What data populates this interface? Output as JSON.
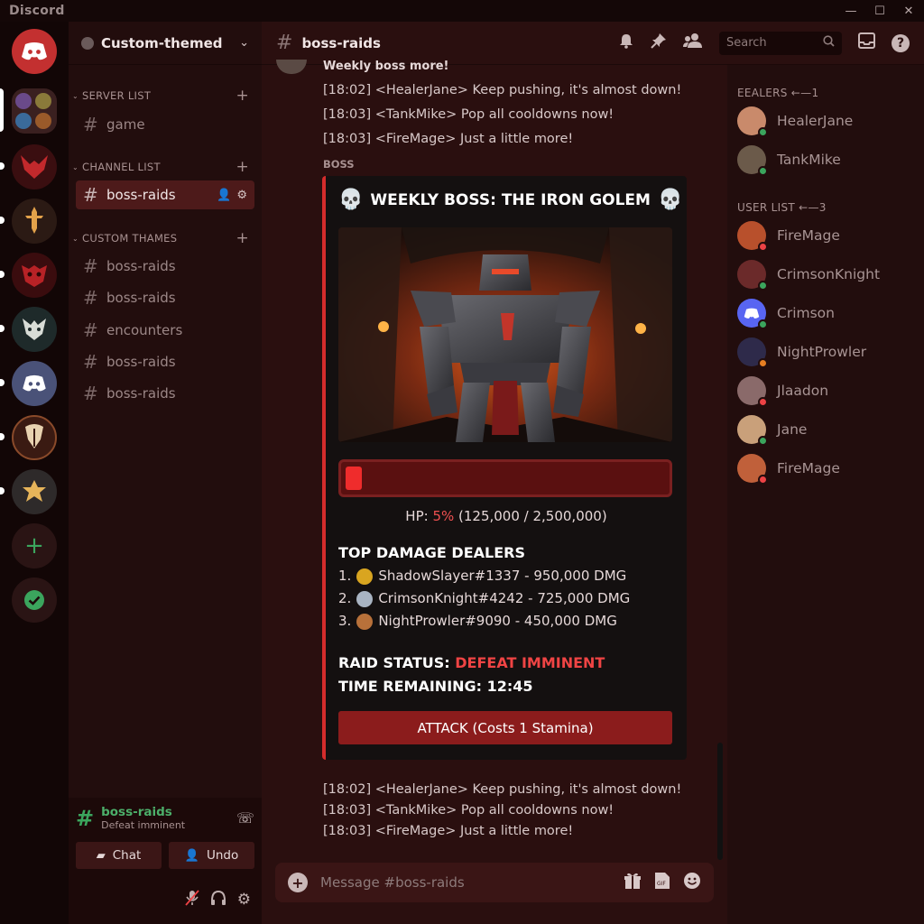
{
  "window": {
    "app_name": "Discord",
    "controls": [
      "—",
      "☐",
      "✕"
    ]
  },
  "server": {
    "name": "Custom-themed"
  },
  "sidebar": {
    "categories": [
      {
        "label": "SERVER LIST",
        "channels": [
          "game"
        ]
      },
      {
        "label": "CHANNEL LIST",
        "channels": [
          "boss-raids"
        ]
      },
      {
        "label": "CUSTOM THAMES",
        "channels": [
          "boss-raids",
          "boss-raids",
          "encounters",
          "boss-raids",
          "boss-raids"
        ]
      }
    ],
    "active_channel": "boss-raids"
  },
  "voice": {
    "channel": "boss-raids",
    "subtitle": "Defeat imminent",
    "chat_label": "Chat",
    "undo_label": "Undo"
  },
  "topbar": {
    "channel": "boss-raids",
    "search_placeholder": "Search"
  },
  "messages": {
    "partial_header": "Weekly boss more!",
    "top": [
      "[18:02] <HealerJane> Keep pushing, it's almost down!",
      "[18:03] <TankMike> Pop all cooldowns now!",
      "[18:03] <FireMage> Just a little more!"
    ],
    "bottom": [
      "[18:02] <HealerJane> Keep pushing, it's almost down!",
      "[18:03] <TankMike> Pop all cooldowns now!",
      "[18:03] <FireMage> Just a little more!"
    ]
  },
  "embed": {
    "author": "BOSS",
    "title": "WEEKLY BOSS: THE IRON GOLEM",
    "hp_prefix": "HP: ",
    "hp_pct": "5%",
    "hp_detail": " (125,000 / 2,500,000)",
    "hp_fraction": 0.05,
    "dealers_title": "TOP DAMAGE DEALERS",
    "dealers": [
      {
        "rank": "1.",
        "text": "ShadowSlayer#1337 - 950,000 DMG",
        "medal_color": "#d9a520"
      },
      {
        "rank": "2.",
        "text": "CrimsonKnight#4242 - 725,000 DMG",
        "medal_color": "#a9b4c2"
      },
      {
        "rank": "3.",
        "text": "NightProwler#9090 - 450,000 DMG",
        "medal_color": "#b8713a"
      }
    ],
    "status_label": "RAID STATUS: ",
    "status_value": "DEFEAT IMMINENT",
    "time_label": "TIME REMAINING: 12:45",
    "attack_label": "ATTACK (Costs 1 Stamina)"
  },
  "composer": {
    "placeholder": "Message #boss-raids"
  },
  "members": {
    "groups": [
      {
        "label": "EEALERS ←—1",
        "items": [
          {
            "name": "HealerJane",
            "color": "#c98a6b",
            "status": "#3ba55d"
          },
          {
            "name": "TankMike",
            "color": "#6b5a4a",
            "status": "#3ba55d"
          }
        ]
      },
      {
        "label": "USER LIST ←—3",
        "items": [
          {
            "name": "FireMage",
            "color": "#b8502c",
            "status": "#ed4245"
          },
          {
            "name": "CrimsonKnight",
            "color": "#6b2a2a",
            "status": "#3ba55d"
          },
          {
            "name": "Crimson",
            "color": "#5865f2",
            "status": "#3ba55d"
          },
          {
            "name": "NightProwler",
            "color": "#2e2a4a",
            "status": "#e67e22"
          },
          {
            "name": "Jlaadon",
            "color": "#8a6a6a",
            "status": "#ed4245"
          },
          {
            "name": "Jane",
            "color": "#c9a07a",
            "status": "#3ba55d"
          },
          {
            "name": "FireMage",
            "color": "#c0603a",
            "status": "#ed4245"
          }
        ]
      }
    ]
  }
}
